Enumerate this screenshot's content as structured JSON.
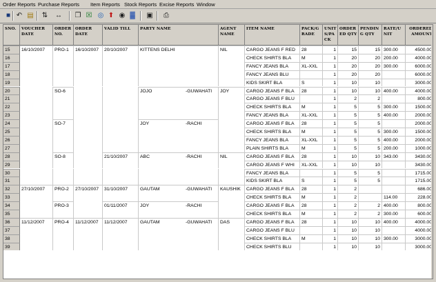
{
  "menu": [
    "Order Reports",
    "Purchase Reports",
    "Item Reports",
    "Stock Reports",
    "Excise Reports",
    "Window"
  ],
  "toolbar": {
    "icons": [
      "save-icon",
      "undo-icon",
      "open-icon",
      "sort-icon",
      "move-icon",
      "copy-icon",
      "excel-icon",
      "web-icon",
      "up-arrow-icon",
      "binoculars-icon",
      "chart-icon",
      "preview-icon",
      "print-icon"
    ]
  },
  "columns": [
    "SNO.",
    "VOUCHER DATE",
    "ORDER NO.",
    "ORDER DATE",
    "VALID TILL",
    "PARTY NAME",
    "AGENT NAME",
    "ITEM NAME",
    "PACK/G RADE",
    "UNIT S/PA CK",
    "ORDER ED QTY",
    "PENDIN G QTY",
    "RATE/U NIT",
    "ORDERED AMOUNT"
  ],
  "rows": [
    {
      "sno": "15",
      "vdate": "16/10/2007",
      "ono": "PRO-1",
      "odate": "16/10/2007",
      "valid": "20/10/2007",
      "party": "KITTENS DELHI",
      "city": "",
      "agent": "NIL",
      "item": "CARGO JEANS F RED",
      "pack": "28",
      "units": "1",
      "oqty": "15",
      "pqty": "15",
      "rate": "300.00",
      "amount": "4500.00"
    },
    {
      "sno": "16",
      "vdate": "",
      "ono": "",
      "odate": "",
      "valid": "",
      "party": "",
      "city": "",
      "agent": "",
      "item": "CHECK SHIRTS BLA",
      "pack": "M",
      "units": "1",
      "oqty": "20",
      "pqty": "20",
      "rate": "200.00",
      "amount": "4000.00"
    },
    {
      "sno": "17",
      "vdate": "",
      "ono": "",
      "odate": "",
      "valid": "",
      "party": "",
      "city": "",
      "agent": "",
      "item": "FANCY JEANS BLA",
      "pack": "XL-XXL",
      "units": "1",
      "oqty": "20",
      "pqty": "20",
      "rate": "300.00",
      "amount": "6000.00"
    },
    {
      "sno": "18",
      "vdate": "",
      "ono": "",
      "odate": "",
      "valid": "",
      "party": "",
      "city": "",
      "agent": "",
      "item": "FANCY JEANS BLU",
      "pack": "",
      "units": "1",
      "oqty": "20",
      "pqty": "20",
      "rate": "",
      "amount": "6000.00"
    },
    {
      "sno": "19",
      "vdate": "",
      "ono": "",
      "odate": "",
      "valid": "",
      "party": "",
      "city": "",
      "agent": "",
      "item": "KIDS SKIRT BLA",
      "pack": "S",
      "units": "1",
      "oqty": "10",
      "pqty": "10",
      "rate": "",
      "amount": "3000.00"
    },
    {
      "sno": "20",
      "vdate": "",
      "ono": "SO-6",
      "odate": "",
      "valid": "",
      "party": "JOJO",
      "city": "-GUWAHATI",
      "agent": "JOY",
      "item": "CARGO JEANS F BLA",
      "pack": "28",
      "units": "1",
      "oqty": "10",
      "pqty": "10",
      "rate": "400.00",
      "amount": "4000.00"
    },
    {
      "sno": "21",
      "vdate": "",
      "ono": "",
      "odate": "",
      "valid": "",
      "party": "",
      "city": "",
      "agent": "",
      "item": "CARGO JEANS F BLU",
      "pack": "",
      "units": "1",
      "oqty": "2",
      "pqty": "2",
      "rate": "",
      "amount": "800.00"
    },
    {
      "sno": "22",
      "vdate": "",
      "ono": "",
      "odate": "",
      "valid": "",
      "party": "",
      "city": "",
      "agent": "",
      "item": "CHECK SHIRTS BLA",
      "pack": "M",
      "units": "1",
      "oqty": "5",
      "pqty": "5",
      "rate": "300.00",
      "amount": "1500.00"
    },
    {
      "sno": "23",
      "vdate": "",
      "ono": "",
      "odate": "",
      "valid": "",
      "party": "",
      "city": "",
      "agent": "",
      "item": "FANCY JEANS BLA",
      "pack": "XL-XXL",
      "units": "1",
      "oqty": "5",
      "pqty": "5",
      "rate": "400.00",
      "amount": "2000.00"
    },
    {
      "sno": "24",
      "vdate": "",
      "ono": "SO-7",
      "odate": "",
      "valid": "",
      "party": "JOY",
      "city": "-RACHI",
      "agent": "",
      "item": "CARGO JEANS F BLA",
      "pack": "28",
      "units": "1",
      "oqty": "5",
      "pqty": "5",
      "rate": "",
      "amount": "2000.00"
    },
    {
      "sno": "25",
      "vdate": "",
      "ono": "",
      "odate": "",
      "valid": "",
      "party": "",
      "city": "",
      "agent": "",
      "item": "CHECK SHIRTS BLA",
      "pack": "M",
      "units": "1",
      "oqty": "5",
      "pqty": "5",
      "rate": "300.00",
      "amount": "1500.00"
    },
    {
      "sno": "26",
      "vdate": "",
      "ono": "",
      "odate": "",
      "valid": "",
      "party": "",
      "city": "",
      "agent": "",
      "item": "FANCY JEANS BLA",
      "pack": "XL-XXL",
      "units": "1",
      "oqty": "5",
      "pqty": "5",
      "rate": "400.00",
      "amount": "2000.00"
    },
    {
      "sno": "27",
      "vdate": "",
      "ono": "",
      "odate": "",
      "valid": "",
      "party": "",
      "city": "",
      "agent": "",
      "item": "PLAIN SHIRTS BLA",
      "pack": "M",
      "units": "1",
      "oqty": "5",
      "pqty": "5",
      "rate": "200.00",
      "amount": "1000.00"
    },
    {
      "sno": "28",
      "vdate": "",
      "ono": "SO-8",
      "odate": "",
      "valid": "21/10/2007",
      "party": "ABC",
      "city": "-RACHI",
      "agent": "NIL",
      "item": "CARGO JEANS F BLA",
      "pack": "28",
      "units": "1",
      "oqty": "10",
      "pqty": "10",
      "rate": "343.00",
      "amount": "3430.00"
    },
    {
      "sno": "29",
      "vdate": "",
      "ono": "",
      "odate": "",
      "valid": "",
      "party": "",
      "city": "",
      "agent": "",
      "item": "CARGO JEANS F WHI",
      "pack": "XL-XXL",
      "units": "1",
      "oqty": "10",
      "pqty": "10",
      "rate": "",
      "amount": "3430.00"
    },
    {
      "sno": "30",
      "vdate": "",
      "ono": "",
      "odate": "",
      "valid": "",
      "party": "",
      "city": "",
      "agent": "",
      "item": "FANCY JEANS BLA",
      "pack": "",
      "units": "1",
      "oqty": "5",
      "pqty": "5",
      "rate": "",
      "amount": "1715.00"
    },
    {
      "sno": "31",
      "vdate": "",
      "ono": "",
      "odate": "",
      "valid": "",
      "party": "",
      "city": "",
      "agent": "",
      "item": "KIDS SKIRT BLA",
      "pack": "S",
      "units": "1",
      "oqty": "5",
      "pqty": "5",
      "rate": "",
      "amount": "1715.00"
    },
    {
      "sno": "32",
      "vdate": "27/10/2007",
      "ono": "PRO-2",
      "odate": "27/10/2007",
      "valid": "31/10/2007",
      "party": "GAUTAM",
      "city": "-GUWAHATI",
      "agent": "KAUSHIK",
      "item": "CARGO JEANS F BLA",
      "pack": "28",
      "units": "1",
      "oqty": "2",
      "pqty": "",
      "rate": "",
      "amount": "686.00"
    },
    {
      "sno": "33",
      "vdate": "",
      "ono": "",
      "odate": "",
      "valid": "",
      "party": "",
      "city": "",
      "agent": "",
      "item": "CHECK SHIRTS BLA",
      "pack": "M",
      "units": "1",
      "oqty": "2",
      "pqty": "",
      "rate": "114.00",
      "amount": "228.00"
    },
    {
      "sno": "34",
      "vdate": "",
      "ono": "PRO-3",
      "odate": "",
      "valid": "01/11/2007",
      "party": "JOY",
      "city": "-RACHI",
      "agent": "",
      "item": "CARGO JEANS F BLA",
      "pack": "28",
      "units": "1",
      "oqty": "2",
      "pqty": "2",
      "rate": "400.00",
      "amount": "800.00"
    },
    {
      "sno": "35",
      "vdate": "",
      "ono": "",
      "odate": "",
      "valid": "",
      "party": "",
      "city": "",
      "agent": "",
      "item": "CHECK SHIRTS BLA",
      "pack": "M",
      "units": "1",
      "oqty": "2",
      "pqty": "2",
      "rate": "300.00",
      "amount": "600.00"
    },
    {
      "sno": "36",
      "vdate": "11/12/2007",
      "ono": "PRO-4",
      "odate": "11/12/2007",
      "valid": "11/12/2007",
      "party": "GAUTAM",
      "city": "-GUWAHATI",
      "agent": "DAS",
      "item": "CARGO JEANS F BLA",
      "pack": "28",
      "units": "1",
      "oqty": "10",
      "pqty": "10",
      "rate": "400.00",
      "amount": "4000.00"
    },
    {
      "sno": "37",
      "vdate": "",
      "ono": "",
      "odate": "",
      "valid": "",
      "party": "",
      "city": "",
      "agent": "",
      "item": "CARGO JEANS F BLU",
      "pack": "",
      "units": "1",
      "oqty": "10",
      "pqty": "10",
      "rate": "",
      "amount": "4000.00"
    },
    {
      "sno": "38",
      "vdate": "",
      "ono": "",
      "odate": "",
      "valid": "",
      "party": "",
      "city": "",
      "agent": "",
      "item": "CHECK SHIRTS BLA",
      "pack": "M",
      "units": "1",
      "oqty": "10",
      "pqty": "10",
      "rate": "300.00",
      "amount": "3000.00"
    },
    {
      "sno": "39",
      "vdate": "",
      "ono": "",
      "odate": "",
      "valid": "",
      "party": "",
      "city": "",
      "agent": "",
      "item": "CHECK SHIRTS BLU",
      "pack": "",
      "units": "1",
      "oqty": "10",
      "pqty": "10",
      "rate": "",
      "amount": "3000.00"
    }
  ]
}
